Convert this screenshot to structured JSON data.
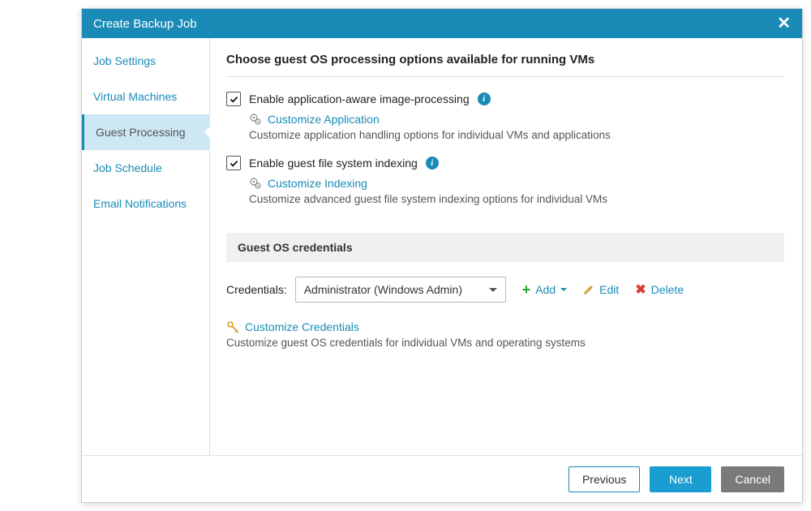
{
  "title": "Create Backup Job",
  "sidebar": {
    "items": [
      {
        "label": "Job Settings"
      },
      {
        "label": "Virtual Machines"
      },
      {
        "label": "Guest Processing"
      },
      {
        "label": "Job Schedule"
      },
      {
        "label": "Email Notifications"
      }
    ]
  },
  "page": {
    "heading": "Choose guest OS processing options available for running VMs",
    "opt1": {
      "label": "Enable application-aware image-processing",
      "link": "Customize Application",
      "desc": "Customize application handling options for individual VMs and applications"
    },
    "opt2": {
      "label": "Enable guest file system indexing",
      "link": "Customize Indexing",
      "desc": "Customize advanced guest file system indexing options for individual VMs"
    },
    "cred_section": "Guest OS credentials",
    "cred_label": "Credentials:",
    "cred_value": "Administrator (Windows Admin)",
    "add": "Add",
    "edit": "Edit",
    "delete": "Delete",
    "customize_cred": "Customize Credentials",
    "customize_cred_desc": "Customize guest OS credentials for individual VMs and operating systems"
  },
  "footer": {
    "previous": "Previous",
    "next": "Next",
    "cancel": "Cancel"
  }
}
